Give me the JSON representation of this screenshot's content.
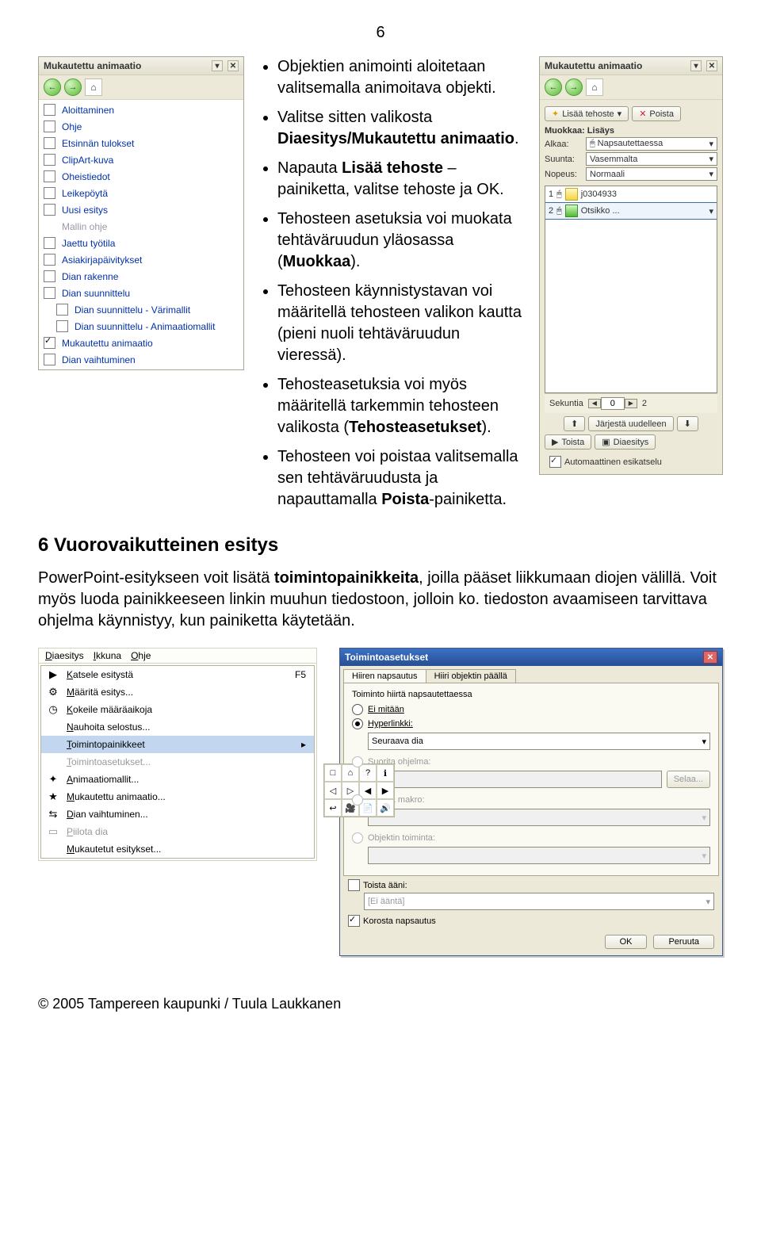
{
  "page_number": "6",
  "left_pane": {
    "title": "Mukautettu animaatio",
    "nav": {
      "back": "←",
      "forward": "→",
      "home": "⌂"
    },
    "items": [
      {
        "label": "Aloittaminen",
        "checkbox": true,
        "checked": false
      },
      {
        "label": "Ohje",
        "checkbox": true,
        "checked": false
      },
      {
        "label": "Etsinnän tulokset",
        "checkbox": true,
        "checked": false
      },
      {
        "label": "ClipArt-kuva",
        "checkbox": true,
        "checked": false
      },
      {
        "label": "Oheistiedot",
        "checkbox": true,
        "checked": false
      },
      {
        "label": "Leikepöytä",
        "checkbox": true,
        "checked": false
      },
      {
        "label": "Uusi esitys",
        "checkbox": true,
        "checked": false
      },
      {
        "label": "Mallin ohje",
        "checkbox": false,
        "grey": true
      },
      {
        "label": "Jaettu työtila",
        "checkbox": true,
        "checked": false
      },
      {
        "label": "Asiakirjapäivitykset",
        "checkbox": true,
        "checked": false
      },
      {
        "label": "Dian rakenne",
        "checkbox": true,
        "checked": false
      },
      {
        "label": "Dian suunnittelu",
        "checkbox": true,
        "checked": false
      },
      {
        "label": "Dian suunnittelu - Värimallit",
        "checkbox": true,
        "checked": false,
        "sub": true
      },
      {
        "label": "Dian suunnittelu - Animaatiomallit",
        "checkbox": true,
        "checked": false,
        "sub": true
      },
      {
        "label": "Mukautettu animaatio",
        "checkbox": true,
        "checked": true
      },
      {
        "label": "Dian vaihtuminen",
        "checkbox": true,
        "checked": false
      }
    ]
  },
  "bullets": [
    {
      "pre": "Objektien animointi aloitetaan valitsemalla animoitava objekti."
    },
    {
      "pre": "Valitse sitten valikosta ",
      "b1": "Diaesitys/Mukautettu animaatio",
      "post": "."
    },
    {
      "pre": "Napauta ",
      "b1": "Lisää tehoste",
      "mid": " –painiketta, valitse tehoste ja OK."
    },
    {
      "pre": "Tehosteen asetuksia voi muokata tehtäväruudun yläosassa (",
      "b1": "Muokkaa",
      "post": ")."
    },
    {
      "pre": "Tehosteen käynnistystavan voi määritellä tehosteen valikon kautta (pieni nuoli tehtäväruudun vieressä)."
    },
    {
      "pre": "Tehosteasetuksia voi myös määritellä tarkemmin tehosteen valikosta (",
      "b1": "Tehosteasetukset",
      "post": ")."
    },
    {
      "pre": "Tehosteen voi poistaa valitsemalla sen tehtäväruudusta ja napauttamalla ",
      "b1": "Poista",
      "post": "-painiketta."
    }
  ],
  "right_pane": {
    "title": "Mukautettu animaatio",
    "add_effect": "Lisää tehoste",
    "remove": "Poista",
    "muokkaa_label": "Muokkaa: Lisäys",
    "fields": {
      "start_label": "Alkaa:",
      "start_val": "Napsautettaessa",
      "direction_label": "Suunta:",
      "direction_val": "Vasemmalta",
      "speed_label": "Nopeus:",
      "speed_val": "Normaali"
    },
    "effects": [
      {
        "num": "1",
        "type": "star",
        "name": "j0304933"
      },
      {
        "num": "2",
        "type": "green",
        "name": "Otsikko ..."
      }
    ],
    "timeline": {
      "label": "Sekuntia",
      "val": "0",
      "end": "2"
    },
    "reorder": "Järjestä uudelleen",
    "play": "Toista",
    "slideshow": "Diaesitys",
    "auto_preview": "Automaattinen esikatselu"
  },
  "heading": "6 Vuorovaikutteinen esitys",
  "paragraph": {
    "a": "PowerPoint-esitykseen voit lisätä ",
    "b": "toimintopainikkeita",
    "c": ", joilla pääset liikkumaan diojen välillä. Voit myös luoda painikkeeseen linkin muuhun tiedostoon, jolloin ko. tiedoston avaamiseen tarvittava ohjelma käynnistyy, kun painiketta käytetään."
  },
  "slide_menu": {
    "menubar": [
      "Diaesitys",
      "Ikkuna",
      "Ohje"
    ],
    "items": [
      {
        "icon": "▶",
        "label": "Katsele esitystä",
        "accel": "F5"
      },
      {
        "icon": "⚙",
        "label": "Määritä esitys..."
      },
      {
        "icon": "◷",
        "label": "Kokeile määräaikoja"
      },
      {
        "icon": "",
        "label": "Nauhoita selostus..."
      },
      {
        "icon": "",
        "label": "Toimintopainikkeet",
        "sub": true,
        "selected": true
      },
      {
        "icon": "",
        "label": "Toimintoasetukset...",
        "grey": true
      },
      {
        "icon": "✦",
        "label": "Animaatiomallit..."
      },
      {
        "icon": "★",
        "label": "Mukautettu animaatio..."
      },
      {
        "icon": "⇆",
        "label": "Dian vaihtuminen..."
      },
      {
        "icon": "▭",
        "label": "Piilota dia",
        "grey": true
      },
      {
        "icon": "",
        "label": "Mukautetut esitykset..."
      }
    ],
    "icon_grid": [
      "□",
      "⌂",
      "?",
      "ℹ",
      "◁",
      "▷",
      "◀",
      "▶",
      "↩",
      "🎥",
      "📄",
      "🔊"
    ]
  },
  "dialog": {
    "title": "Toimintoasetukset",
    "tabs": [
      "Hiiren napsautus",
      "Hiiri objektin päällä"
    ],
    "group_label": "Toiminto hiirtä napsautettaessa",
    "radios": {
      "none": "Ei mitään",
      "hyperlink": "Hyperlinkki:",
      "hyperlink_val": "Seuraava dia",
      "run_prog": "Suorita ohjelma:",
      "browse": "Selaa...",
      "run_macro": "Suorita makro:",
      "object_action": "Objektin toiminta:"
    },
    "sound": {
      "chk": "Toista ääni:",
      "val": "[Ei ääntä]"
    },
    "highlight": "Korosta napsautus",
    "ok": "OK",
    "cancel": "Peruuta"
  },
  "footer": "© 2005 Tampereen kaupunki / Tuula Laukkanen"
}
